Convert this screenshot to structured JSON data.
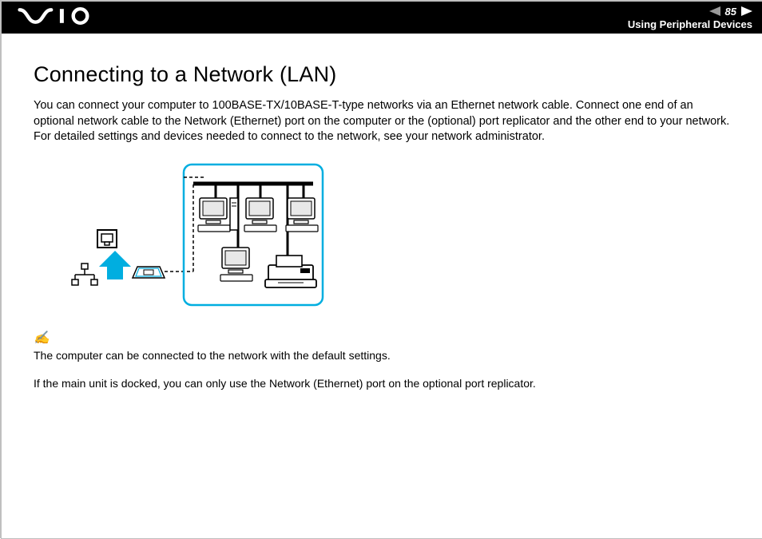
{
  "header": {
    "logo": "VAIO",
    "page_number": "85",
    "section": "Using Peripheral Devices"
  },
  "title": "Connecting to a Network (LAN)",
  "intro": "You can connect your computer to 100BASE-TX/10BASE-T-type networks via an Ethernet network cable. Connect one end of an optional network cable to the Network (Ethernet) port on the computer or the (optional) port replicator and the other end to your network. For detailed settings and devices needed to connect to the network, see your network administrator.",
  "note_icon": "✍",
  "notes": [
    "The computer can be connected to the network with the default settings.",
    "If the main unit is docked, you can only use the Network (Ethernet) port on the optional port replicator."
  ]
}
